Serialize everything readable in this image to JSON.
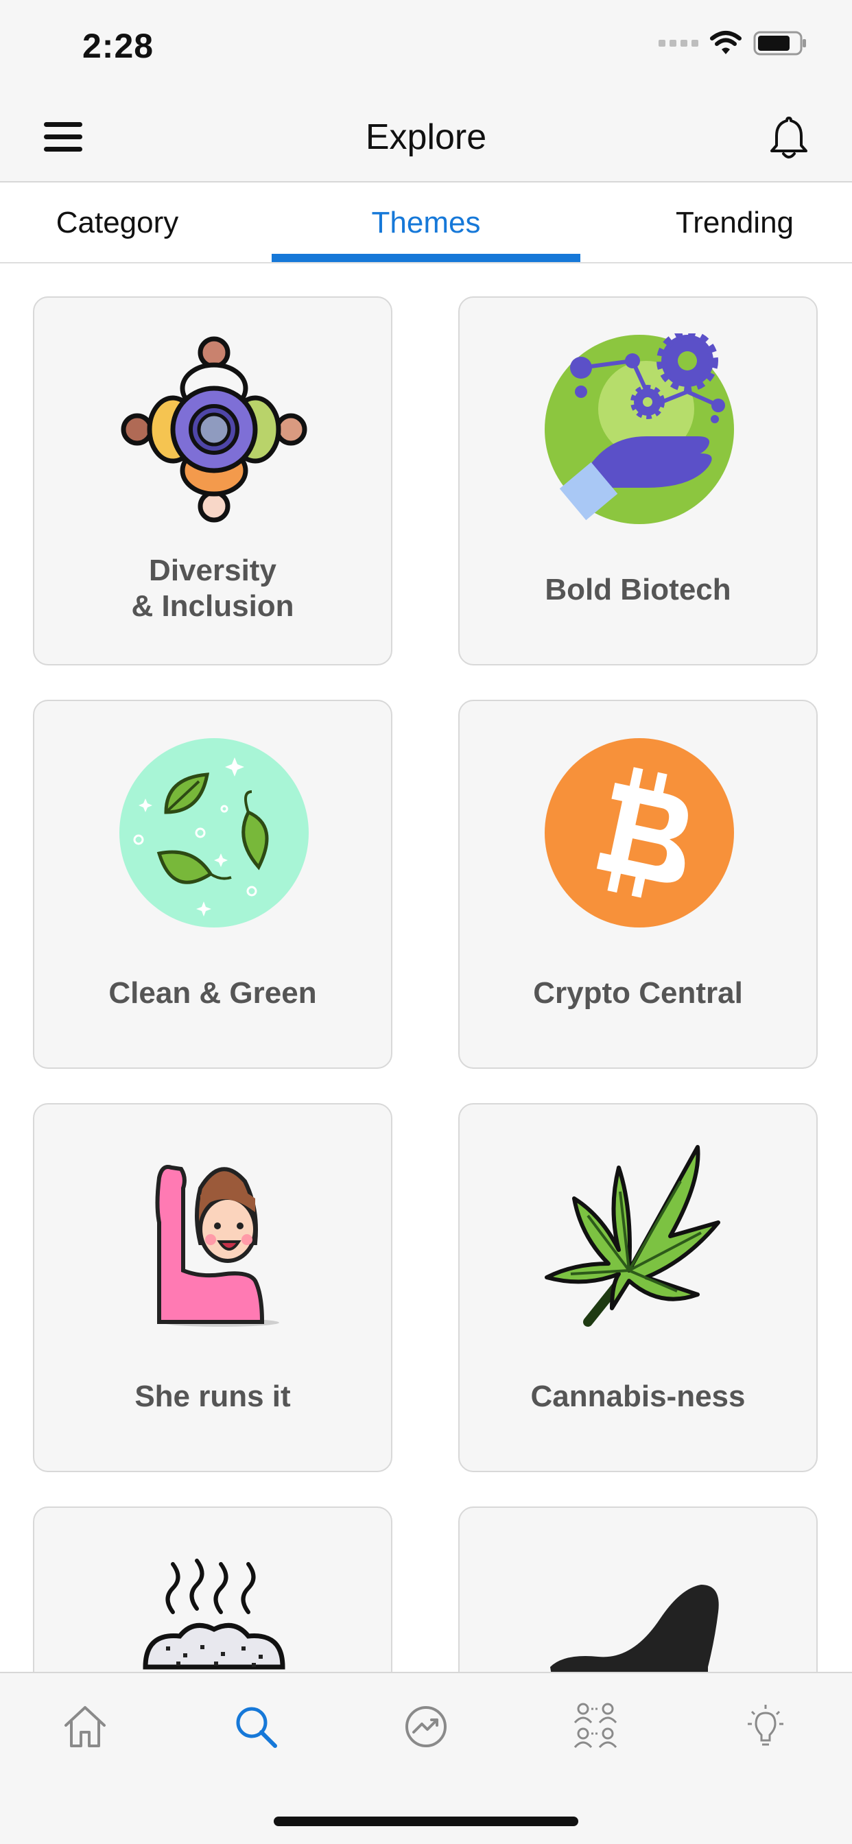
{
  "status_bar": {
    "time": "2:28"
  },
  "header": {
    "title": "Explore"
  },
  "tabs": [
    {
      "label": "Category",
      "active": false
    },
    {
      "label": "Themes",
      "active": true
    },
    {
      "label": "Trending",
      "active": false
    }
  ],
  "accent_color": "#1678d8",
  "themes": [
    {
      "label_line1": "Diversity",
      "label_line2": "& Inclusion",
      "icon": "diversity-people-icon"
    },
    {
      "label": "Bold Biotech",
      "icon": "biotech-hand-gears-icon"
    },
    {
      "label": "Clean & Green",
      "icon": "leaves-circle-icon"
    },
    {
      "label": "Crypto Central",
      "icon": "bitcoin-icon"
    },
    {
      "label": "She runs it",
      "icon": "woman-raising-hand-icon"
    },
    {
      "label": "Cannabis-ness",
      "icon": "cannabis-leaf-icon"
    },
    {
      "label": "",
      "icon": "steaming-food-icon"
    },
    {
      "label": "",
      "icon": "high-heel-icon"
    }
  ],
  "bottom_nav": [
    {
      "icon": "home-icon",
      "active": false
    },
    {
      "icon": "search-icon",
      "active": true
    },
    {
      "icon": "trending-icon",
      "active": false
    },
    {
      "icon": "community-icon",
      "active": false
    },
    {
      "icon": "lightbulb-icon",
      "active": false
    }
  ]
}
